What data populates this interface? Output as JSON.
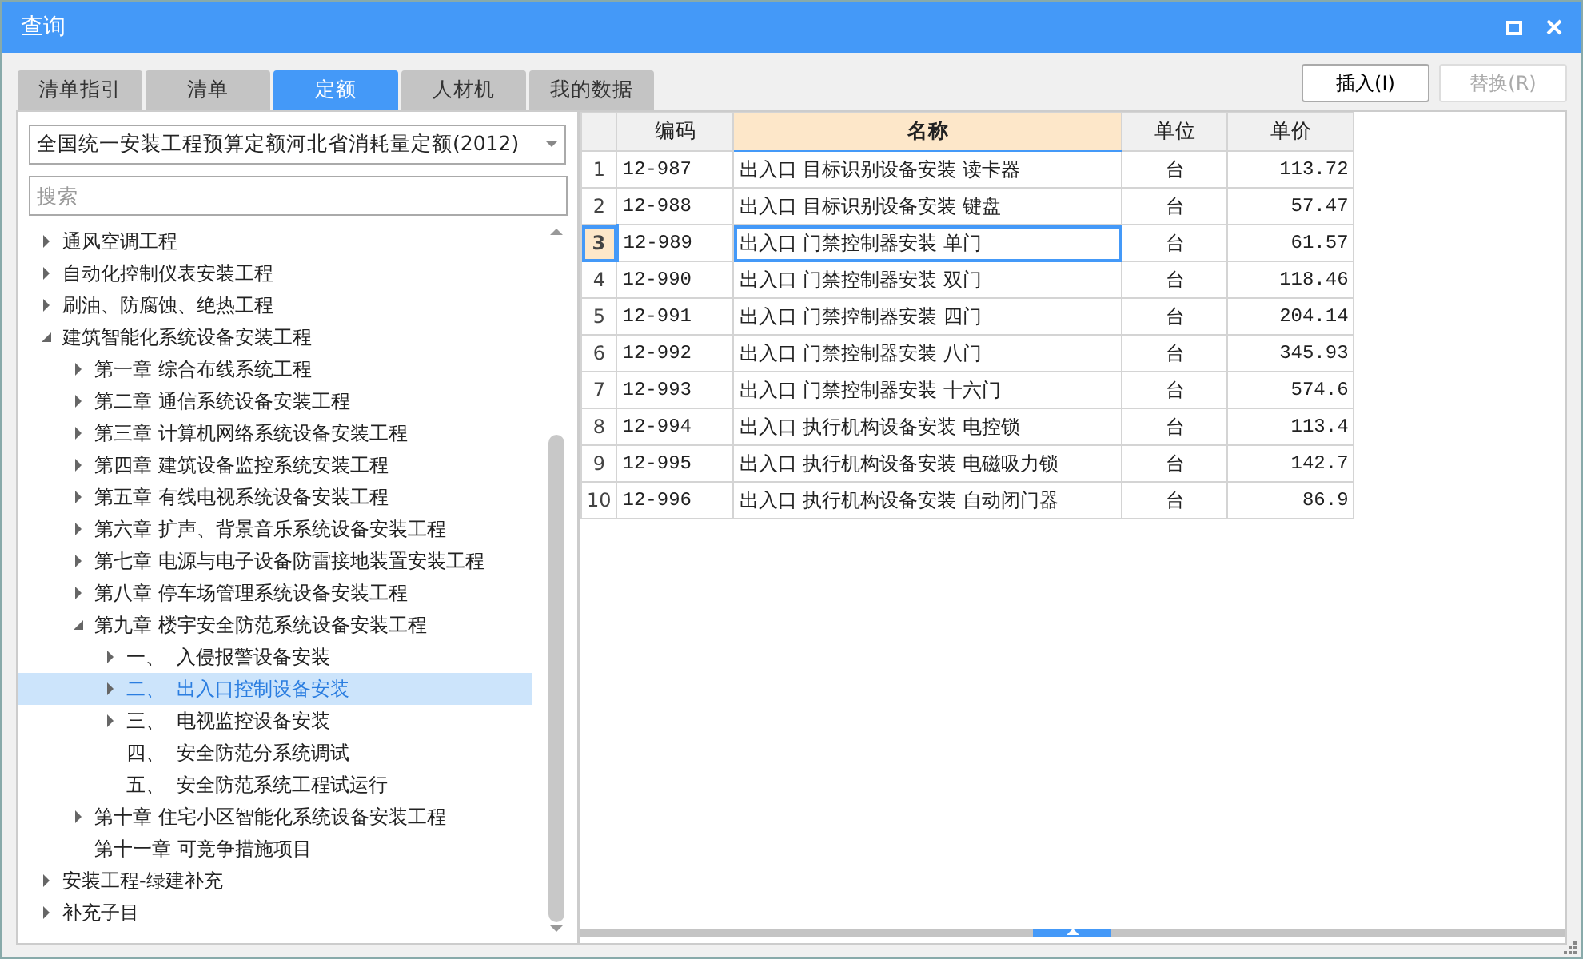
{
  "window": {
    "title": "查询"
  },
  "tabs": [
    {
      "label": "清单指引",
      "selected": false
    },
    {
      "label": "清单",
      "selected": false
    },
    {
      "label": "定额",
      "selected": true
    },
    {
      "label": "人材机",
      "selected": false
    },
    {
      "label": "我的数据",
      "selected": false
    }
  ],
  "buttons": [
    {
      "label": "插入(I)",
      "disabled": false
    },
    {
      "label": "替换(R)",
      "disabled": true
    }
  ],
  "library": {
    "value": "全国统一安装工程预算定额河北省消耗量定额(2012)"
  },
  "search": {
    "placeholder": "搜索"
  },
  "tree": [
    {
      "label": "通风空调工程",
      "kind": "branch",
      "expanded": false,
      "selected": false
    },
    {
      "label": "自动化控制仪表安装工程",
      "kind": "branch",
      "expanded": false,
      "selected": false
    },
    {
      "label": "刷油、防腐蚀、绝热工程",
      "kind": "branch",
      "expanded": false,
      "selected": false
    },
    {
      "label": "建筑智能化系统设备安装工程",
      "kind": "branch",
      "expanded": true,
      "selected": false,
      "children": [
        {
          "label": "第一章 综合布线系统工程",
          "kind": "branch",
          "expanded": false,
          "selected": false
        },
        {
          "label": "第二章 通信系统设备安装工程",
          "kind": "branch",
          "expanded": false,
          "selected": false
        },
        {
          "label": "第三章 计算机网络系统设备安装工程",
          "kind": "branch",
          "expanded": false,
          "selected": false
        },
        {
          "label": "第四章 建筑设备监控系统安装工程",
          "kind": "branch",
          "expanded": false,
          "selected": false
        },
        {
          "label": "第五章 有线电视系统设备安装工程",
          "kind": "branch",
          "expanded": false,
          "selected": false
        },
        {
          "label": "第六章 扩声、背景音乐系统设备安装工程",
          "kind": "branch",
          "expanded": false,
          "selected": false
        },
        {
          "label": "第七章 电源与电子设备防雷接地装置安装工程",
          "kind": "branch",
          "expanded": false,
          "selected": false
        },
        {
          "label": "第八章 停车场管理系统设备安装工程",
          "kind": "branch",
          "expanded": false,
          "selected": false
        },
        {
          "label": "第九章 楼宇安全防范系统设备安装工程",
          "kind": "branch",
          "expanded": true,
          "selected": false,
          "children": [
            {
              "label": "一、  入侵报警设备安装",
              "kind": "branch",
              "expanded": false,
              "selected": false
            },
            {
              "label": "二、  出入口控制设备安装",
              "kind": "branch",
              "expanded": false,
              "selected": true
            },
            {
              "label": "三、  电视监控设备安装",
              "kind": "branch",
              "expanded": false,
              "selected": false
            },
            {
              "label": "四、  安全防范分系统调试",
              "kind": "leaf",
              "selected": false
            },
            {
              "label": "五、  安全防范系统工程试运行",
              "kind": "leaf",
              "selected": false
            }
          ]
        },
        {
          "label": "第十章 住宅小区智能化系统设备安装工程",
          "kind": "branch",
          "expanded": false,
          "selected": false
        },
        {
          "label": "第十一章 可竞争措施项目",
          "kind": "leaf",
          "selected": false
        }
      ]
    },
    {
      "label": "安装工程-绿建补充",
      "kind": "branch",
      "expanded": false,
      "selected": false
    },
    {
      "label": "补充子目",
      "kind": "branch",
      "expanded": false,
      "selected": false
    }
  ],
  "table": {
    "columns": [
      {
        "label": "编码",
        "selected": false
      },
      {
        "label": "名称",
        "selected": true
      },
      {
        "label": "单位",
        "selected": false
      },
      {
        "label": "单价",
        "selected": false
      }
    ],
    "rows": [
      {
        "index": "1",
        "code": "12-987",
        "name": "出入口 目标识别设备安装 读卡器",
        "unit": "台",
        "price": "113.72",
        "selected": false
      },
      {
        "index": "2",
        "code": "12-988",
        "name": "出入口 目标识别设备安装 键盘",
        "unit": "台",
        "price": "57.47",
        "selected": false
      },
      {
        "index": "3",
        "code": "12-989",
        "name": "出入口 门禁控制器安装 单门",
        "unit": "台",
        "price": "61.57",
        "selected": true
      },
      {
        "index": "4",
        "code": "12-990",
        "name": "出入口 门禁控制器安装 双门",
        "unit": "台",
        "price": "118.46",
        "selected": false
      },
      {
        "index": "5",
        "code": "12-991",
        "name": "出入口 门禁控制器安装 四门",
        "unit": "台",
        "price": "204.14",
        "selected": false
      },
      {
        "index": "6",
        "code": "12-992",
        "name": "出入口 门禁控制器安装 八门",
        "unit": "台",
        "price": "345.93",
        "selected": false
      },
      {
        "index": "7",
        "code": "12-993",
        "name": "出入口 门禁控制器安装 十六门",
        "unit": "台",
        "price": "574.6",
        "selected": false
      },
      {
        "index": "8",
        "code": "12-994",
        "name": "出入口 执行机构设备安装 电控锁",
        "unit": "台",
        "price": "113.4",
        "selected": false
      },
      {
        "index": "9",
        "code": "12-995",
        "name": "出入口 执行机构设备安装 电磁吸力锁",
        "unit": "台",
        "price": "142.7",
        "selected": false
      },
      {
        "index": "10",
        "code": "12-996",
        "name": "出入口 执行机构设备安装 自动闭门器",
        "unit": "台",
        "price": "86.9",
        "selected": false
      }
    ]
  }
}
